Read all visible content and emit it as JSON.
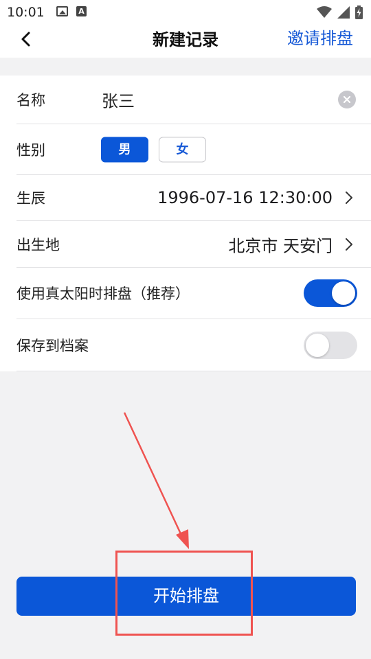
{
  "status_bar": {
    "time": "10:01",
    "icons": [
      "image-icon",
      "text-a-icon",
      "wifi-icon",
      "signal-icon",
      "battery-charging-icon"
    ],
    "a_glyph": "A"
  },
  "nav": {
    "title": "新建记录",
    "action_label": "邀请排盘",
    "back_icon": "chevron-left-icon"
  },
  "form": {
    "name": {
      "label": "名称",
      "value": "张三"
    },
    "gender": {
      "label": "性别",
      "options": [
        "男",
        "女"
      ],
      "selected": "男"
    },
    "birth": {
      "label": "生辰",
      "value": "1996-07-16 12:30:00"
    },
    "place": {
      "label": "出生地",
      "value": "北京市 天安门"
    },
    "solar_time": {
      "label": "使用真太阳时排盘（推荐）",
      "enabled": true
    },
    "save_profile": {
      "label": "保存到档案",
      "enabled": false
    }
  },
  "actions": {
    "start_label": "开始排盘"
  },
  "colors": {
    "primary": "#0b57d8",
    "link": "#1558d6",
    "annotation": "#ef5350",
    "page_bg": "#f2f2f3"
  }
}
